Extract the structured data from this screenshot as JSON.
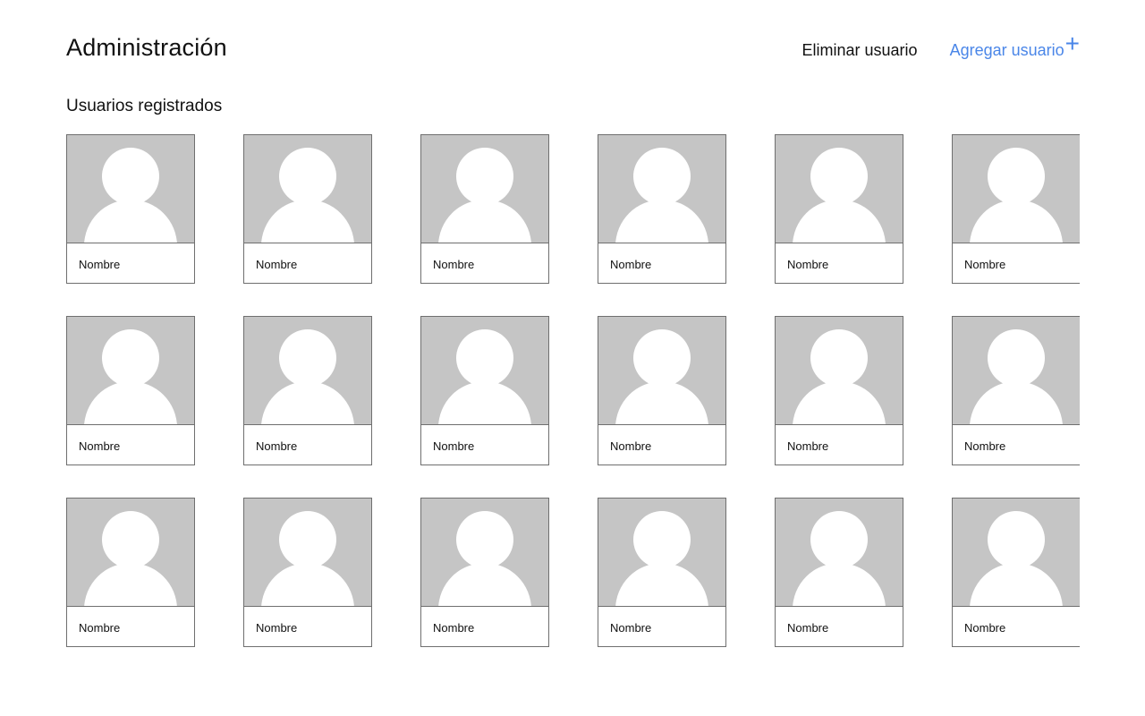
{
  "header": {
    "title": "Administración",
    "delete_label": "Eliminar usuario",
    "add_label": "Agregar usuario",
    "add_icon": "+"
  },
  "section": {
    "title": "Usuarios registrados"
  },
  "colors": {
    "accent": "#4a86e8",
    "avatar_bg": "#c5c5c5",
    "border": "#6f6f6f"
  },
  "users": [
    {
      "name": "Nombre"
    },
    {
      "name": "Nombre"
    },
    {
      "name": "Nombre"
    },
    {
      "name": "Nombre"
    },
    {
      "name": "Nombre"
    },
    {
      "name": "Nombre"
    },
    {
      "name": "Nombre"
    },
    {
      "name": "Nombre"
    },
    {
      "name": "Nombre"
    },
    {
      "name": "Nombre"
    },
    {
      "name": "Nombre"
    },
    {
      "name": "Nombre"
    },
    {
      "name": "Nombre"
    },
    {
      "name": "Nombre"
    },
    {
      "name": "Nombre"
    },
    {
      "name": "Nombre"
    },
    {
      "name": "Nombre"
    },
    {
      "name": "Nombre"
    }
  ]
}
